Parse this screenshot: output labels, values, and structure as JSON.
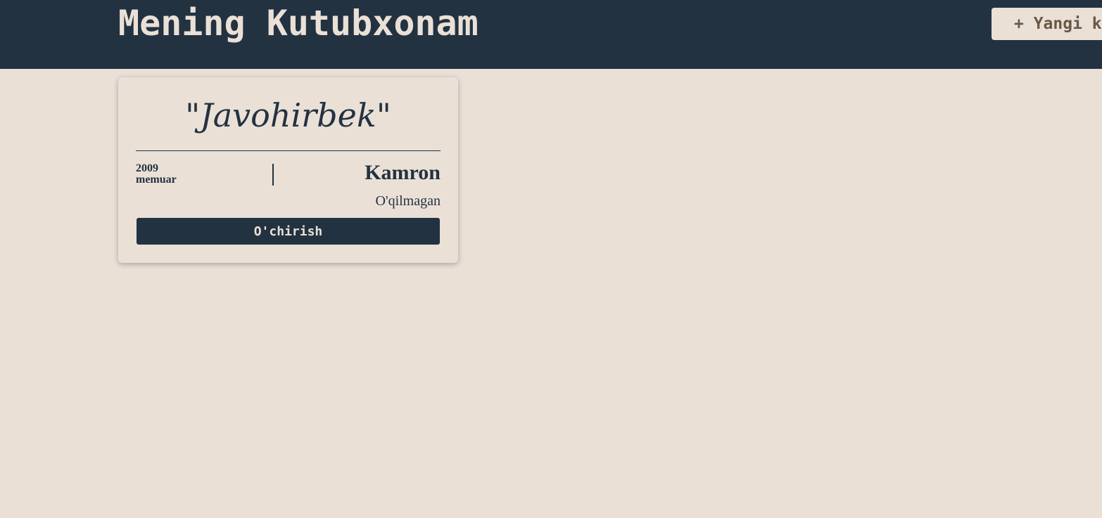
{
  "header": {
    "title": "Mening Kutubxonam",
    "add_button_label": "+ Yangi kitob"
  },
  "books": [
    {
      "title": "\"Javohirbek\"",
      "year": "2009",
      "genre": "memuar",
      "author": "Kamron",
      "status": "O'qilmagan",
      "delete_label": "O'chirish"
    }
  ],
  "colors": {
    "header_bg": "#233241",
    "page_bg": "#eae0d6",
    "text_dark": "#233241",
    "accent_brown": "#6b5844"
  }
}
